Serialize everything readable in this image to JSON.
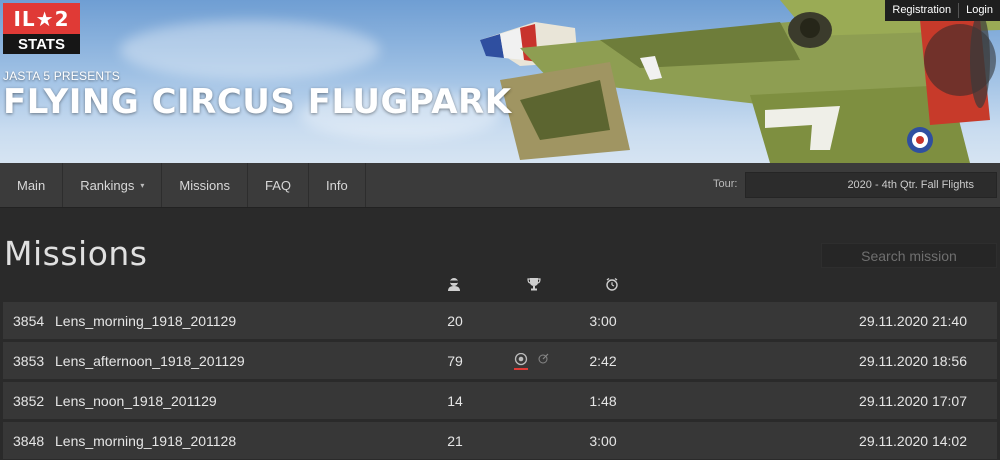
{
  "logo": {
    "top": "IL★2",
    "bottom": "STATS"
  },
  "header": {
    "presents": "JASTA 5 PRESENTS",
    "title": "FLYING CIRCUS FLUGPARK"
  },
  "auth": {
    "registration": "Registration",
    "login": "Login"
  },
  "nav": {
    "items": [
      {
        "label": "Main"
      },
      {
        "label": "Rankings",
        "caret": "▾"
      },
      {
        "label": "Missions"
      },
      {
        "label": "FAQ"
      },
      {
        "label": "Info"
      }
    ],
    "tour_label": "Tour:",
    "tour_value": "2020 - 4th Qtr. Fall Flights"
  },
  "page": {
    "title": "Missions",
    "search_placeholder": "Search mission"
  },
  "columns": {
    "players_icon": "pilot-icon",
    "winner_icon": "trophy-icon",
    "duration_icon": "stopwatch-icon"
  },
  "missions": [
    {
      "id": "3854",
      "name": "Lens_morning_1918_201129",
      "players": "20",
      "duration": "3:00",
      "date": "29.11.2020 21:40",
      "objectives": false
    },
    {
      "id": "3853",
      "name": "Lens_afternoon_1918_201129",
      "players": "79",
      "duration": "2:42",
      "date": "29.11.2020 18:56",
      "objectives": true
    },
    {
      "id": "3852",
      "name": "Lens_noon_1918_201129",
      "players": "14",
      "duration": "1:48",
      "date": "29.11.2020 17:07",
      "objectives": false
    },
    {
      "id": "3848",
      "name": "Lens_morning_1918_201128",
      "players": "21",
      "duration": "3:00",
      "date": "29.11.2020 14:02",
      "objectives": false
    }
  ],
  "colors": {
    "brand_red": "#e03a36",
    "background": "#2a2a2a",
    "row": "#373737",
    "nav": "#3b3b3b"
  }
}
